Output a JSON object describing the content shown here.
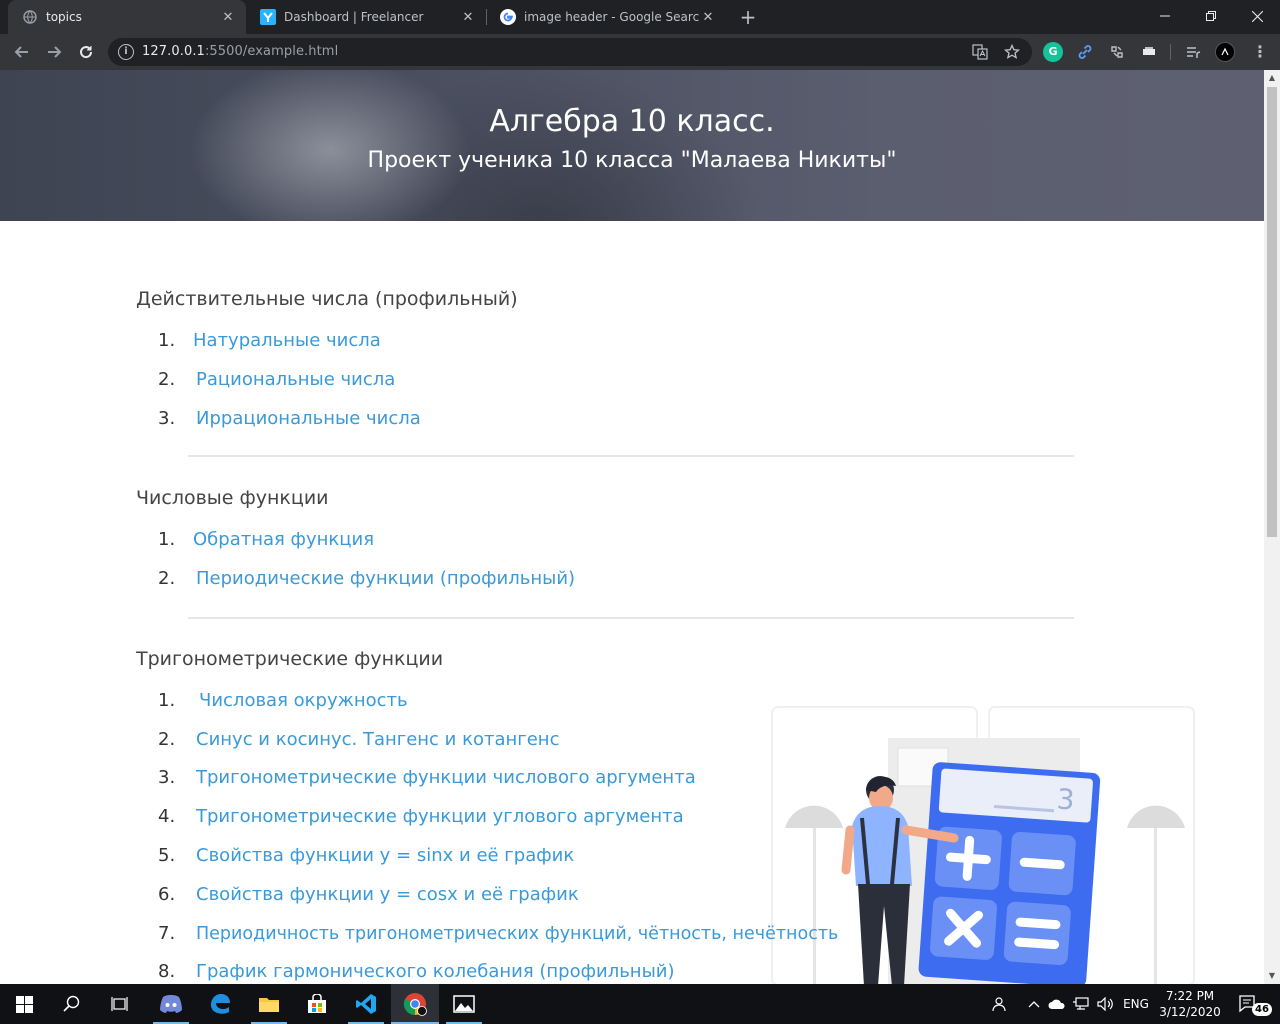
{
  "browser": {
    "tabs": [
      {
        "title": "topics",
        "active": true
      },
      {
        "title": "Dashboard | Freelancer",
        "active": false
      },
      {
        "title": "image header - Google Search",
        "active": false
      }
    ],
    "url_host": "127.0.0.1",
    "url_rest": ":5500/example.html",
    "extension_grammarly": "G"
  },
  "hero": {
    "title": "Алгебра 10 класс.",
    "subtitle": "Проект ученика 10 класса \"Малаева Никиты\""
  },
  "sections": [
    {
      "title": "Действительные числа (профильный)",
      "items": [
        {
          "num": "1.",
          "label": "Натуральные числа"
        },
        {
          "num": "2.",
          "label": "Рациональные числа"
        },
        {
          "num": "3.",
          "label": "Иррациональные числа"
        }
      ]
    },
    {
      "title": "Числовые функции",
      "items": [
        {
          "num": "1.",
          "label": "Обратная функция"
        },
        {
          "num": "2.",
          "label": "Периодические функции (профильный)"
        }
      ]
    },
    {
      "title": "Тригонометрические функции",
      "items": [
        {
          "num": "1.",
          "label": "Числовая окружность"
        },
        {
          "num": "2.",
          "label": "Синус и косинус. Тангенс и котангенс"
        },
        {
          "num": "3.",
          "label": "Тригонометрические функции числового аргумента"
        },
        {
          "num": "4.",
          "label": "Тригонометрические функции углового аргумента"
        },
        {
          "num": "5.",
          "label": "Свойства функции y = sinx и её график"
        },
        {
          "num": "6.",
          "label": "Свойства функции y = cosx и её график"
        },
        {
          "num": "7.",
          "label": "Периодичность тригонометрических функций, чётность, нечётность"
        },
        {
          "num": "8.",
          "label": "График гармонического колебания (профильный)"
        }
      ]
    }
  ],
  "illustration": {
    "display_digit": "3"
  },
  "taskbar": {
    "lang": "ENG",
    "time": "7:22 PM",
    "date": "3/12/2020",
    "notifications": "46"
  }
}
